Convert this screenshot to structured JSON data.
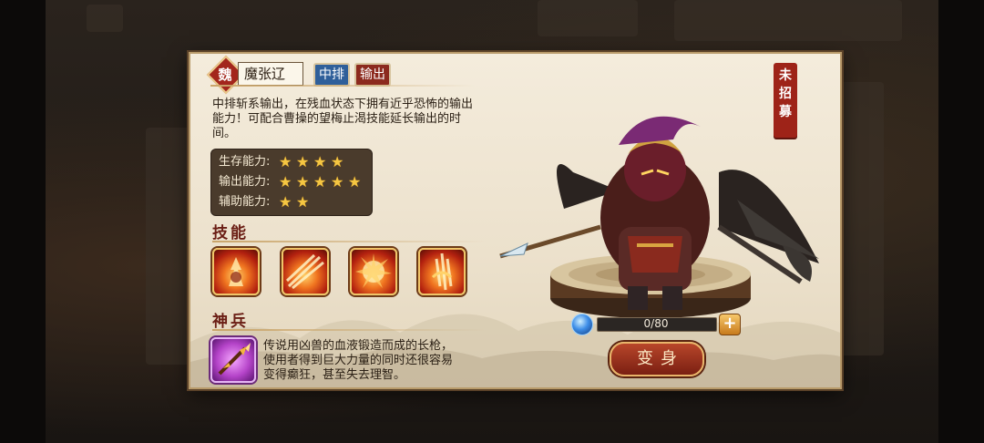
{
  "hero": {
    "faction": "魏",
    "name": "魔张辽",
    "position_tag": "中排",
    "role_tag": "输出",
    "description": "中排斩系输出，在残血状态下拥有近乎恐怖的输出能力！可配合曹操的望梅止渴技能延长输出的时间。",
    "recruit_status": [
      "未",
      "招",
      "募"
    ]
  },
  "stats": [
    {
      "label": "生存能力:",
      "stars": 4
    },
    {
      "label": "输出能力:",
      "stars": 5
    },
    {
      "label": "辅助能力:",
      "stars": 2
    }
  ],
  "skills": {
    "title": "技能",
    "items": [
      "skill-1",
      "skill-2",
      "skill-3",
      "skill-4"
    ]
  },
  "weapon": {
    "title": "神兵",
    "description": "传说用凶兽的血液锻造而成的长枪，使用者得到巨大力量的同时还很容易变得癫狂，甚至失去理智。"
  },
  "shards": {
    "current": 0,
    "required": 80,
    "label": "0/80",
    "plus_label": "+"
  },
  "transform_button": "变身",
  "colors": {
    "panel": "#f4ecdc",
    "accent_red": "#9e2318",
    "stat_bg": "#4a3b2c",
    "star": "#f5c642"
  }
}
